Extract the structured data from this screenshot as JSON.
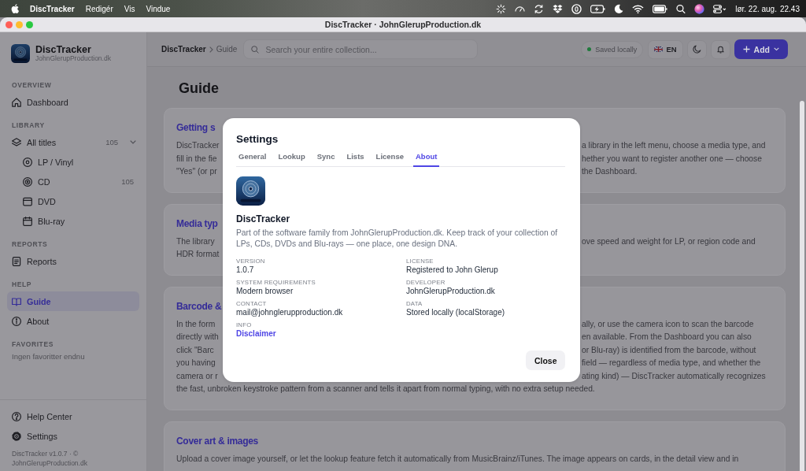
{
  "menu_bar": {
    "app_name": "DiscTracker",
    "menus": [
      "Redigér",
      "Vis",
      "Vindue"
    ],
    "date": "lør. 22. aug.",
    "time": "22.43"
  },
  "window": {
    "title": "DiscTracker · JohnGlerupProduction.dk"
  },
  "sidebar": {
    "brand": {
      "name": "DiscTracker",
      "site": "JohnGlerupProduction.dk"
    },
    "sections": [
      {
        "heading": "OVERVIEW",
        "items": [
          {
            "label": "Dashboard",
            "kind": "home",
            "selected": false
          }
        ]
      },
      {
        "heading": "LIBRARY",
        "items": [
          {
            "label": "All titles",
            "kind": "layers",
            "selected": false,
            "count": "105",
            "expanded": true,
            "children": [
              {
                "label": "LP / Vinyl",
                "kind": "vinyl",
                "selected": false
              },
              {
                "label": "CD",
                "kind": "cd",
                "selected": false,
                "count": "105"
              },
              {
                "label": "DVD",
                "kind": "dvd",
                "selected": false
              },
              {
                "label": "Blu-ray",
                "kind": "bluray",
                "selected": false
              }
            ]
          }
        ]
      },
      {
        "heading": "REPORTS",
        "items": [
          {
            "label": "Reports",
            "kind": "report",
            "selected": false
          }
        ]
      },
      {
        "heading": "HELP",
        "items": [
          {
            "label": "Guide",
            "kind": "book",
            "selected": true
          },
          {
            "label": "About",
            "kind": "info",
            "selected": false
          }
        ]
      },
      {
        "heading": "FAVORITES",
        "empty_text": "Ingen favoritter endnu"
      }
    ],
    "bottom_items": [
      {
        "label": "Help Center",
        "kind": "help",
        "selected": false
      },
      {
        "label": "Settings",
        "kind": "gear",
        "selected": false
      }
    ],
    "footer": "DiscTracker v1.0.7 · © JohnGlerupProduction.dk"
  },
  "header": {
    "breadcrumb": [
      "DiscTracker",
      "Guide"
    ],
    "search": {
      "placeholder": "Search your entire collection..."
    },
    "save_status": "Saved locally",
    "language": "EN",
    "add_button": "Add"
  },
  "guide": {
    "title": "Guide",
    "sections": [
      {
        "title": "Getting s",
        "lines": [
          {
            "kind": "split",
            "left": "DiscTracker",
            "right": "a library in the left menu, choose a media type, and"
          },
          {
            "kind": "split",
            "left": "fill in the fie",
            "right": "hether you want to register another one — choose"
          },
          {
            "kind": "split",
            "left": "\"Yes\" (or pr",
            "right": "the Dashboard."
          }
        ]
      },
      {
        "title": "Media typ",
        "lines": [
          {
            "kind": "split",
            "left": "The library",
            "right": "ove speed and weight for LP, or region code and"
          },
          {
            "kind": "split",
            "left": "HDR format"
          }
        ]
      },
      {
        "title": "Barcode &",
        "lines": [
          {
            "kind": "split",
            "left": "In the form",
            "right": "ally, or use the camera icon to scan the barcode"
          },
          {
            "kind": "split",
            "left": "directly with",
            "right": "en available. From the Dashboard you can also"
          },
          {
            "kind": "split",
            "left": "click \"Barc",
            "right": "or Blu-ray) is identified from the barcode, without"
          },
          {
            "kind": "split",
            "left": "you having",
            "right": "field — regardless of media type, and whether the"
          },
          {
            "kind": "split",
            "left": "camera or r",
            "right": "ating kind) — DiscTracker automatically recognizes"
          },
          {
            "kind": "full",
            "text": "the fast, unbroken keystroke pattern from a scanner and tells it apart from normal typing, with no extra setup needed."
          }
        ]
      },
      {
        "title": "Cover art & images",
        "lines": [
          {
            "kind": "full",
            "text": "Upload a cover image yourself, or let the lookup feature fetch it automatically from MusicBrainz/iTunes. The image appears on cards, in the detail view and in"
          }
        ]
      }
    ]
  },
  "settings_dialog": {
    "title": "Settings",
    "tabs": [
      {
        "label": "General",
        "selected": false
      },
      {
        "label": "Lookup",
        "selected": false
      },
      {
        "label": "Sync",
        "selected": false
      },
      {
        "label": "Lists",
        "selected": false
      },
      {
        "label": "License",
        "selected": false
      },
      {
        "label": "About",
        "selected": true
      }
    ],
    "app_name": "DiscTracker",
    "description": "Part of the software family from JohnGlerupProduction.dk. Keep track of your collection of LPs, CDs, DVDs and Blu-rays — one place, one design DNA.",
    "info": [
      {
        "label": "VERSION",
        "value": "1.0.7",
        "kind": "text"
      },
      {
        "label": "LICENSE",
        "value": "Registered to John Glerup",
        "kind": "text"
      },
      {
        "label": "SYSTEM REQUIREMENTS",
        "value": "Modern browser",
        "kind": "text"
      },
      {
        "label": "DEVELOPER",
        "value": "JohnGlerupProduction.dk",
        "kind": "text"
      },
      {
        "label": "CONTACT",
        "value": "mail@johnglerupproduction.dk",
        "kind": "text"
      },
      {
        "label": "DATA",
        "value": "Stored locally (localStorage)",
        "kind": "text"
      },
      {
        "label": "INFO",
        "value": "Disclaimer",
        "kind": "link"
      }
    ],
    "close_button": "Close"
  }
}
